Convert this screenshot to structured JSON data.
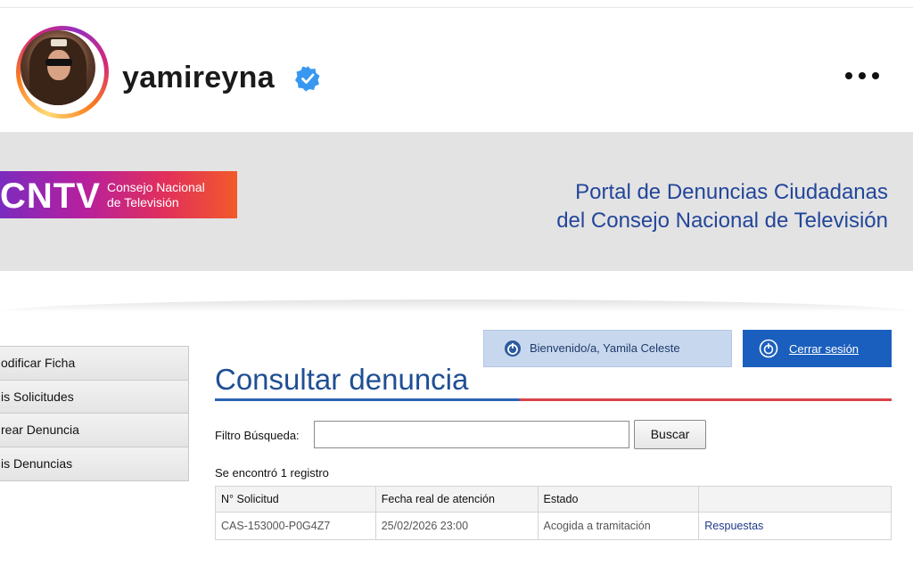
{
  "instagram": {
    "username": "yamireyna",
    "verified": true
  },
  "banner": {
    "logo_word": "CNTV",
    "logo_sub_line1": "Consejo Nacional",
    "logo_sub_line2": "de Televisión",
    "portal_line1": "Portal de Denuncias Ciudadanas",
    "portal_line2": "del Consejo Nacional de Televisión"
  },
  "sidebar": {
    "items": [
      {
        "label": "odificar Ficha"
      },
      {
        "label": "is Solicitudes"
      },
      {
        "label": "rear Denuncia"
      },
      {
        "label": "is Denuncias"
      }
    ]
  },
  "session": {
    "welcome": "Bienvenido/a, Yamila Celeste",
    "logout": "Cerrar sesión"
  },
  "main": {
    "title": "Consultar denuncia",
    "filter_label": "Filtro Búsqueda:",
    "filter_value": "",
    "search_button": "Buscar",
    "count_text": "Se encontró 1 registro"
  },
  "table": {
    "headers": [
      "N° Solicitud",
      "Fecha real de atención",
      "Estado",
      ""
    ],
    "rows": [
      {
        "solicitud": "CAS-153000-P0G4Z7",
        "fecha": "25/02/2026 23:00",
        "estado": "Acogida a tramitación",
        "accion": "Respuestas"
      }
    ]
  },
  "colors": {
    "accent_blue": "#1b5fbe",
    "title_blue": "#1f4f93",
    "rule_red": "#d9434a"
  }
}
